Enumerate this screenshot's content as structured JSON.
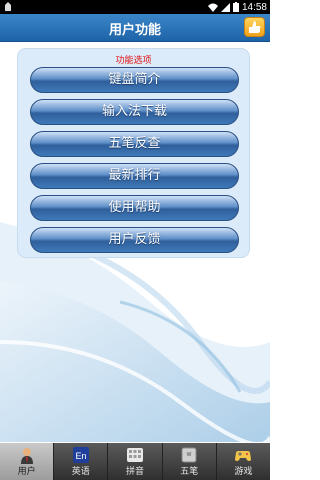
{
  "status_bar": {
    "time": "14:58"
  },
  "header": {
    "title": "用户功能"
  },
  "panel": {
    "title": "功能选项",
    "buttons": [
      "键盘简介",
      "输入法下载",
      "五笔反查",
      "最新排行",
      "使用帮助",
      "用户反馈"
    ]
  },
  "tabs": [
    {
      "label": "用户",
      "icon": "user-icon",
      "active": true
    },
    {
      "label": "英语",
      "icon": "english-icon",
      "active": false
    },
    {
      "label": "拼音",
      "icon": "pinyin-icon",
      "active": false
    },
    {
      "label": "五笔",
      "icon": "wubi-icon",
      "active": false
    },
    {
      "label": "游戏",
      "icon": "game-icon",
      "active": false
    }
  ],
  "colors": {
    "header": "#2a74ba",
    "panel": "#dcebfa",
    "accent_red": "#e01010"
  }
}
